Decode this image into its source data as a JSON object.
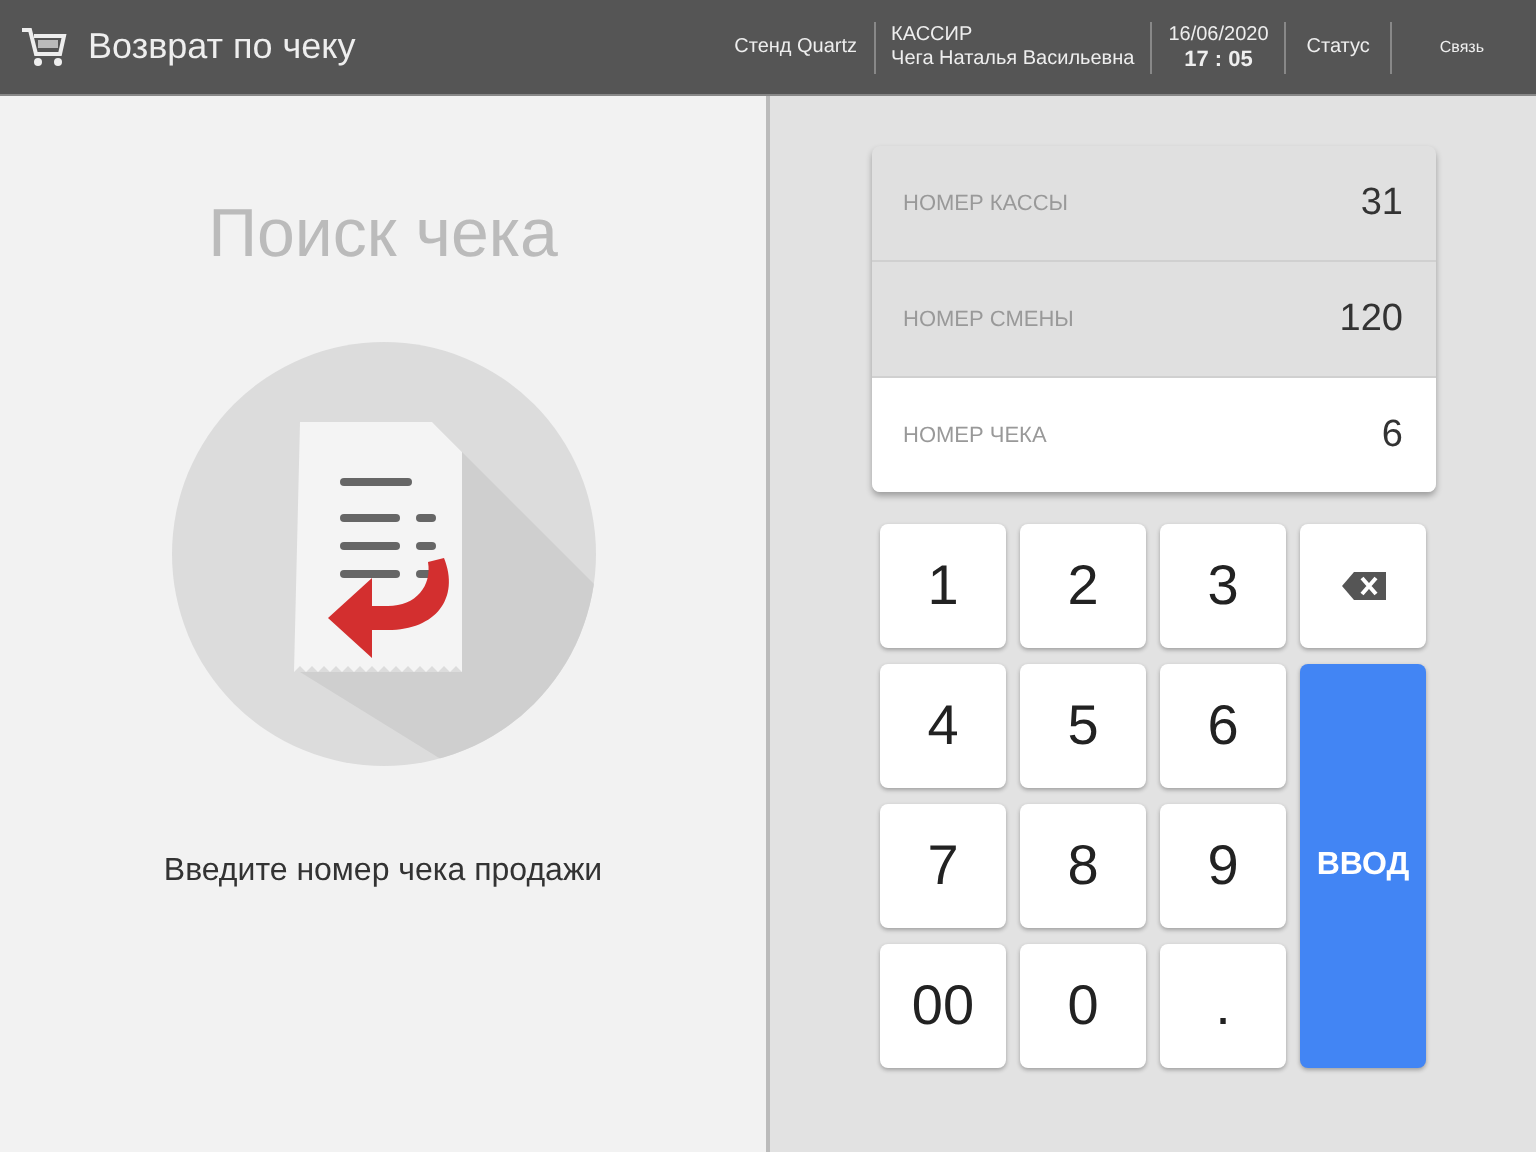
{
  "header": {
    "title": "Возврат по чеку",
    "stand": "Стенд Quartz",
    "cashier_label": "КАССИР",
    "cashier_name": "Чега Наталья Васильевна",
    "date": "16/06/2020",
    "time": "17 : 05",
    "status": "Статус",
    "connection": "Связь"
  },
  "left": {
    "heading": "Поиск чека",
    "hint": "Введите номер чека продажи"
  },
  "fields": [
    {
      "label": "НОМЕР КАССЫ",
      "value": "31",
      "selected": false
    },
    {
      "label": "НОМЕР СМЕНЫ",
      "value": "120",
      "selected": false
    },
    {
      "label": "НОМЕР ЧЕКА",
      "value": "6",
      "selected": true
    }
  ],
  "keys": [
    "1",
    "2",
    "3",
    "4",
    "5",
    "6",
    "7",
    "8",
    "9",
    "00",
    "0",
    "."
  ],
  "enter_key": "ВВОД"
}
